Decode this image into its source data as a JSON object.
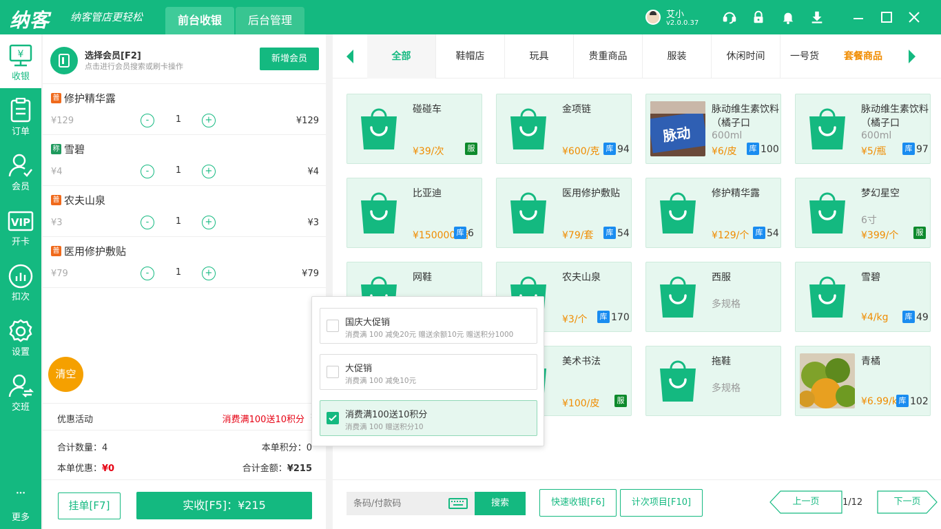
{
  "app": {
    "logo": "纳客",
    "slogan": "纳客管店更轻松",
    "tabs": [
      "前台收银",
      "后台管理"
    ],
    "user_name": "艾小",
    "version": "v2.0.0.37"
  },
  "sidebar": {
    "items": [
      {
        "label": "收银",
        "icon": "cashier-icon"
      },
      {
        "label": "订单",
        "icon": "order-icon"
      },
      {
        "label": "会员",
        "icon": "member-icon"
      },
      {
        "label": "开卡",
        "icon": "vip-card-icon"
      },
      {
        "label": "扣次",
        "icon": "deduct-icon"
      },
      {
        "label": "设置",
        "icon": "gear-icon"
      },
      {
        "label": "交班",
        "icon": "handover-icon"
      },
      {
        "label": "更多",
        "icon": "more-icon"
      }
    ]
  },
  "member": {
    "title": "选择会员[F2]",
    "subtitle": "点击进行会员搜索或刷卡操作",
    "new_button": "新增会员"
  },
  "cart": {
    "items": [
      {
        "badge": "普",
        "badge_color": "#f06a1c",
        "name": "修护精华露",
        "price": "¥129",
        "qty": "1",
        "total": "¥129"
      },
      {
        "badge": "称",
        "badge_color": "#1f9a5e",
        "name": "雪碧",
        "price": "¥4",
        "qty": "1",
        "total": "¥4"
      },
      {
        "badge": "普",
        "badge_color": "#f06a1c",
        "name": "农夫山泉",
        "price": "¥3",
        "qty": "1",
        "total": "¥3"
      },
      {
        "badge": "普",
        "badge_color": "#f06a1c",
        "name": "医用修护敷贴",
        "price": "¥79",
        "qty": "1",
        "total": "¥79"
      }
    ],
    "minus": "-",
    "plus": "+",
    "clear_button": "清空"
  },
  "promotion": {
    "label": "优惠活动",
    "value": "消费满100送10积分",
    "arrow": "›"
  },
  "summary": {
    "count_label": "合计数量：",
    "count_value": "4",
    "points_label": "本单积分：",
    "points_value": "0",
    "discount_label": "本单优惠：",
    "discount_value": "¥0",
    "amount_label": "合计金额：",
    "amount_value": "¥215"
  },
  "actions": {
    "hold": "挂单[F7]",
    "pay": "实收[F5]：¥215"
  },
  "categories": [
    "全部",
    "鞋帽店",
    "玩具",
    "贵重商品",
    "服装",
    "休闲时间",
    "一号货",
    "套餐商品"
  ],
  "products": [
    {
      "name": "碰碰车",
      "price": "¥39/次",
      "tag": "服",
      "tag_color": "dgreen",
      "stock": ""
    },
    {
      "name": "金项链",
      "price": "¥600/克",
      "tag": "库",
      "tag_color": "blue",
      "stock": "94"
    },
    {
      "name": "脉动维生素饮料（橘子口",
      "spec": "600ml",
      "price": "¥6/皮",
      "tag": "库",
      "tag_color": "blue",
      "stock": "100",
      "photo": "bottle"
    },
    {
      "name": "脉动维生素饮料（橘子口",
      "spec": "600ml",
      "price": "¥5/瓶",
      "tag": "库",
      "tag_color": "blue",
      "stock": "97"
    },
    {
      "name": "比亚迪",
      "price": "¥150000/辆",
      "tag": "库",
      "tag_color": "blue",
      "stock": "6"
    },
    {
      "name": "医用修护敷贴",
      "price": "¥79/套",
      "tag": "库",
      "tag_color": "blue",
      "stock": "54"
    },
    {
      "name": "修护精华露",
      "price": "¥129/个",
      "tag": "库",
      "tag_color": "blue",
      "stock": "54"
    },
    {
      "name": "梦幻星空",
      "spec": "6寸",
      "price": "¥399/个",
      "tag": "服",
      "tag_color": "dgreen",
      "stock": ""
    },
    {
      "name": "网鞋",
      "price": "",
      "tag": "",
      "tag_color": "",
      "stock": ""
    },
    {
      "name": "农夫山泉",
      "price": "¥3/个",
      "tag": "库",
      "tag_color": "blue",
      "stock": "170"
    },
    {
      "name": "西服",
      "spec": "多规格",
      "price": "",
      "tag": "",
      "tag_color": "",
      "stock": ""
    },
    {
      "name": "雪碧",
      "price": "¥4/kg",
      "tag": "库",
      "tag_color": "blue",
      "stock": "49"
    },
    {
      "name": "",
      "price": "",
      "tag": "",
      "tag_color": "",
      "stock": ""
    },
    {
      "name": "美术书法",
      "price": "¥100/皮",
      "tag": "服",
      "tag_color": "dgreen",
      "stock": ""
    },
    {
      "name": "拖鞋",
      "spec": "多规格",
      "price": "",
      "tag": "",
      "tag_color": "",
      "stock": ""
    },
    {
      "name": "青橘",
      "price": "¥6.99/kg",
      "tag": "库",
      "tag_color": "blue",
      "stock": "102",
      "photo": "orange"
    }
  ],
  "promo_popup": [
    {
      "title": "国庆大促销",
      "desc": "消费满 100 减免20元 赠送余额10元 赠送积分1000",
      "checked": false
    },
    {
      "title": "大促销",
      "desc": "消费满 100 减免10元",
      "checked": false
    },
    {
      "title": "消费满100送10积分",
      "desc": "消费满 100 赠送积分10",
      "checked": true
    }
  ],
  "bottom": {
    "search_placeholder": "条码/付款码",
    "search_button": "搜索",
    "quick_cash": "快速收银[F6]",
    "count_item": "计次项目[F10]",
    "prev": "上一页",
    "page": "1/12",
    "next": "下一页"
  },
  "colors": {
    "brand": "#14b980",
    "price": "#f08c00",
    "alert": "#e60012"
  }
}
